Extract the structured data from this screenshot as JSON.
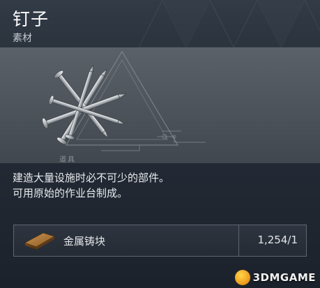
{
  "item": {
    "name": "钉子",
    "type": "素材",
    "category_tag": "道具",
    "description": [
      "建造大量设施时必不可少的部件。",
      "可用原始的作业台制成。"
    ],
    "icon": "nails-icon"
  },
  "requirement": {
    "material_name": "金属铸块",
    "material_icon": "metal-ingot-icon",
    "count": "1,254/1"
  },
  "watermark": {
    "text": "3DMGAME"
  },
  "colors": {
    "header_bg": "#2e3640",
    "preview_bg": "#555b62",
    "text_primary": "#ffffff",
    "text_secondary": "#c4c9cf",
    "row_border": "#5e6670"
  }
}
